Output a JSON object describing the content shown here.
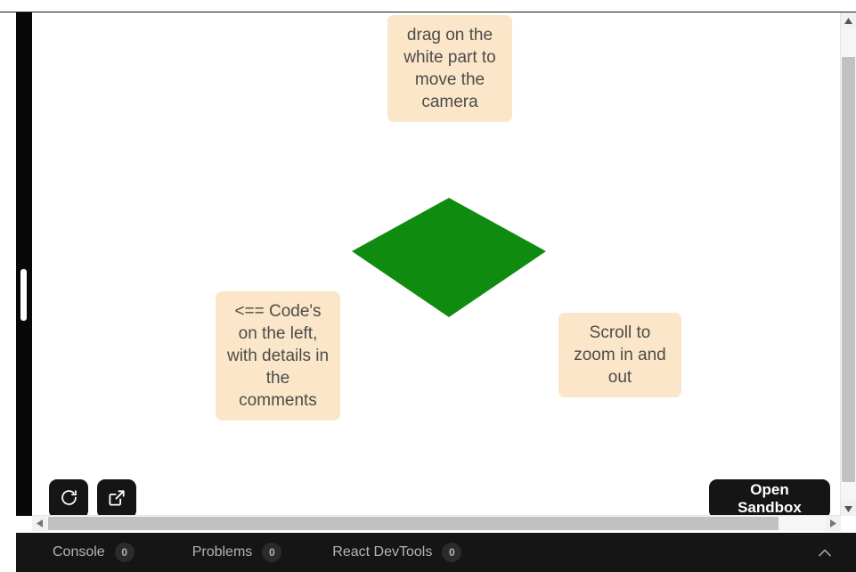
{
  "window": {
    "background": "#ffffff",
    "editor_strip_color": "#080808"
  },
  "preview": {
    "background": "#ffffff",
    "shape": {
      "name": "green-plane",
      "type": "rhombus",
      "fill": "#0f8c10"
    },
    "notes": [
      {
        "id": "camera",
        "text": "drag on the white part to move the camera",
        "background": "#fbe6c9",
        "text_color": "#4d4c49"
      },
      {
        "id": "code",
        "text": "<== Code's on the left, with details in the comments",
        "background": "#fbe6c9",
        "text_color": "#4d4c49"
      },
      {
        "id": "zoom",
        "text": "Scroll to zoom in and out",
        "background": "#fbe6c9",
        "text_color": "#4d4c49"
      }
    ]
  },
  "actions": {
    "reload_icon": "refresh-icon",
    "open_in_new_icon": "external-link-icon",
    "open_sandbox_label": "Open Sandbox",
    "button_background": "#151515"
  },
  "devtools": {
    "background": "#151515",
    "tabs": [
      {
        "label": "Console",
        "count": "0"
      },
      {
        "label": "Problems",
        "count": "0"
      },
      {
        "label": "React DevTools",
        "count": "0"
      }
    ],
    "collapse_icon": "chevron-up-icon"
  },
  "scrollbars": {
    "vertical": {
      "up_icon": "triangle-up-icon",
      "down_icon": "triangle-down-icon",
      "thumb_color": "#c1c1c1"
    },
    "horizontal": {
      "left_icon": "triangle-left-icon",
      "right_icon": "triangle-right-icon",
      "thumb_color": "#c1c1c1"
    }
  }
}
